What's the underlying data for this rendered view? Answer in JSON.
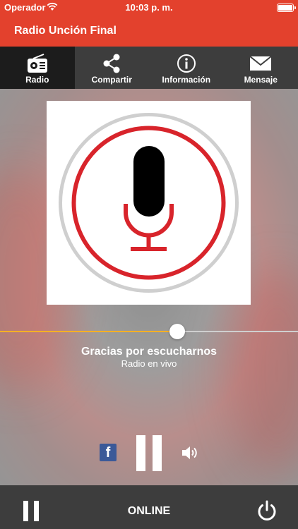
{
  "status_bar": {
    "carrier": "Operador",
    "time": "10:03 p. m."
  },
  "header": {
    "title": "Radio Unción Final"
  },
  "tabs": [
    {
      "label": "Radio",
      "icon": "radio-icon",
      "active": true
    },
    {
      "label": "Compartir",
      "icon": "share-icon",
      "active": false
    },
    {
      "label": "Información",
      "icon": "info-icon",
      "active": false
    },
    {
      "label": "Mensaje",
      "icon": "mail-icon",
      "active": false
    }
  ],
  "player": {
    "cover_icon": "microphone-icon",
    "progress": 0.595,
    "track_title": "Gracias por escucharnos",
    "track_subtitle": "Radio en vivo",
    "facebook_letter": "f",
    "controls": [
      "facebook-icon",
      "pause-icon",
      "speaker-icon"
    ]
  },
  "bottom_bar": {
    "status": "ONLINE",
    "left_icon": "pause-icon",
    "right_icon": "power-icon"
  },
  "colors": {
    "accent": "#e3412d",
    "tab_bg": "#3d3d3d",
    "tab_active_bg": "#1c1c1c",
    "progress": "#f5b025",
    "mic_red": "#d8242b",
    "facebook": "#3b5998"
  }
}
